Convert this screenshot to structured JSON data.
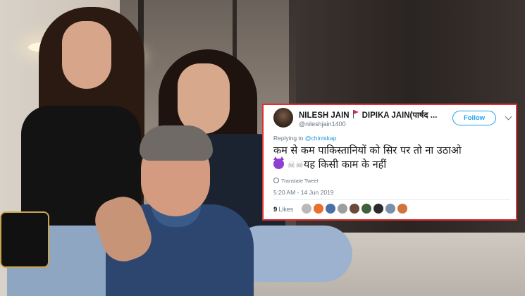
{
  "tweet": {
    "display_name": "NILESH JAIN",
    "display_name_suffix": "DIPIKA JAIN(पार्षद ...",
    "handle": "@nileshjain1400",
    "follow_label": "Follow",
    "replying_prefix": "Replying to",
    "replying_to": "@chintskap",
    "text_line1": "कम से कम पाकिस्तानियों को सिर पर तो ना उठाओ",
    "text_line2": "यह किसी काम के नहीं",
    "translate_label": "Translate Tweet",
    "timestamp": "5:20 AM - 14 Jun 2019",
    "likes_count": "9",
    "likes_label": "Likes"
  },
  "icons": {
    "flag": "red-flag-icon",
    "emoji_1": "smiling-devil-emoji",
    "emoji_2": "skull-crossbones-emoji",
    "menu": "chevron-down-icon",
    "translate": "globe-icon"
  },
  "colors": {
    "border": "#e03131",
    "accent": "#1da1f2",
    "muted": "#657786",
    "text": "#14171a"
  },
  "likers": [
    {
      "color": "#b9b9b9"
    },
    {
      "color": "#e8702a"
    },
    {
      "color": "#4a6fa5"
    },
    {
      "color": "#9e9e9e"
    },
    {
      "color": "#6b4a3a"
    },
    {
      "color": "#3f5f3f"
    },
    {
      "color": "#2b2b2b"
    },
    {
      "color": "#7b8fa8"
    },
    {
      "color": "#d0743c"
    }
  ]
}
